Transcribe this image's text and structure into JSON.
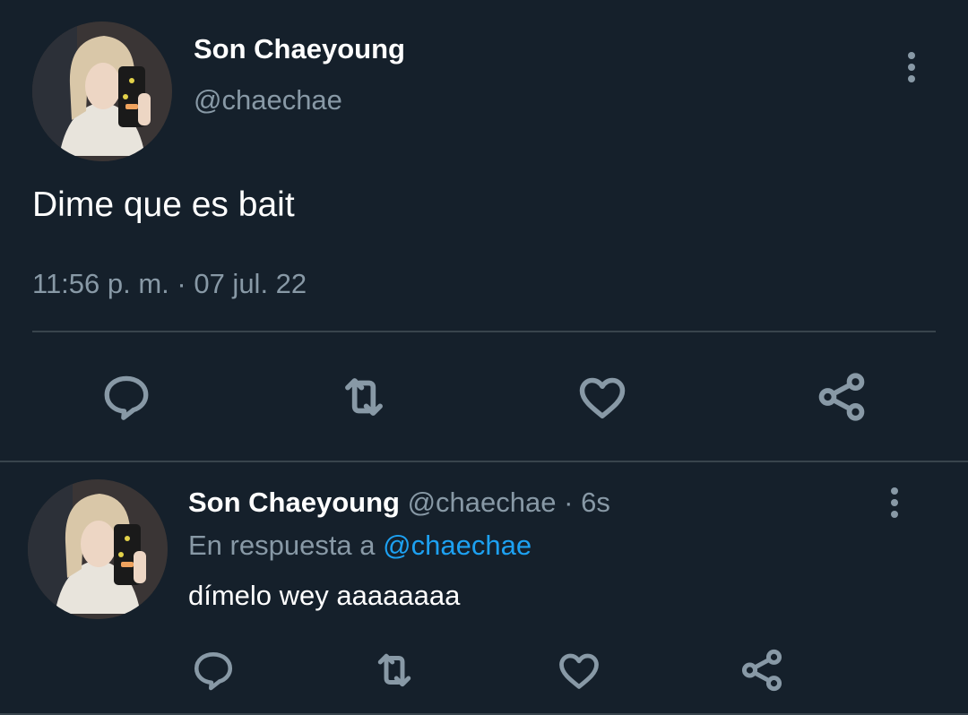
{
  "tweet": {
    "author": {
      "name": "Son Chaeyoung",
      "handle": "@chaechae"
    },
    "text": "Dime que es bait",
    "timestamp": "11:56 p. m. · 07 jul. 22",
    "actions": [
      "reply-icon",
      "retweet-icon",
      "like-icon",
      "share-icon"
    ]
  },
  "reply": {
    "author": {
      "name": "Son Chaeyoung",
      "handle": "@chaechae",
      "separator": "·",
      "age": "6s"
    },
    "in_reply_to_prefix": "En respuesta a",
    "in_reply_to_handle": "@chaechae",
    "text": "dímelo wey aaaaaaaa",
    "actions": [
      "reply-icon",
      "retweet-icon",
      "like-icon",
      "share-icon"
    ]
  },
  "colors": {
    "background": "#15202b",
    "text": "#ffffff",
    "muted": "#8899a6",
    "link": "#1da1f2",
    "divider": "#38444d"
  }
}
